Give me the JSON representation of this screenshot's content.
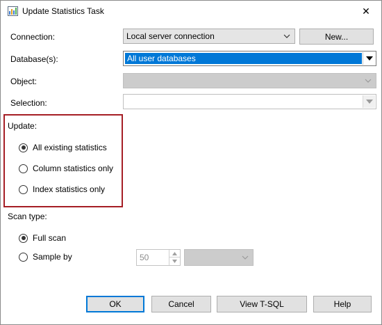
{
  "window": {
    "title": "Update Statistics Task",
    "close_glyph": "✕"
  },
  "form": {
    "connection_label": "Connection:",
    "connection_value": "Local server connection",
    "new_button": "New...",
    "database_label": "Database(s):",
    "database_value": "All user databases",
    "object_label": "Object:",
    "object_value": "",
    "selection_label": "Selection:",
    "selection_value": ""
  },
  "update_group": {
    "label": "Update:",
    "options": [
      {
        "label": "All existing statistics",
        "checked": true
      },
      {
        "label": "Column statistics only",
        "checked": false
      },
      {
        "label": "Index statistics only",
        "checked": false
      }
    ]
  },
  "scan_group": {
    "label": "Scan type:",
    "options": [
      {
        "label": "Full scan",
        "checked": true
      },
      {
        "label": "Sample by",
        "checked": false
      }
    ],
    "sample_value": "50",
    "sample_unit": ""
  },
  "buttons": {
    "ok": "OK",
    "cancel": "Cancel",
    "view_tsql": "View T-SQL",
    "help": "Help"
  },
  "colors": {
    "highlight_border": "#a51d24",
    "selection_blue": "#0078d7"
  }
}
